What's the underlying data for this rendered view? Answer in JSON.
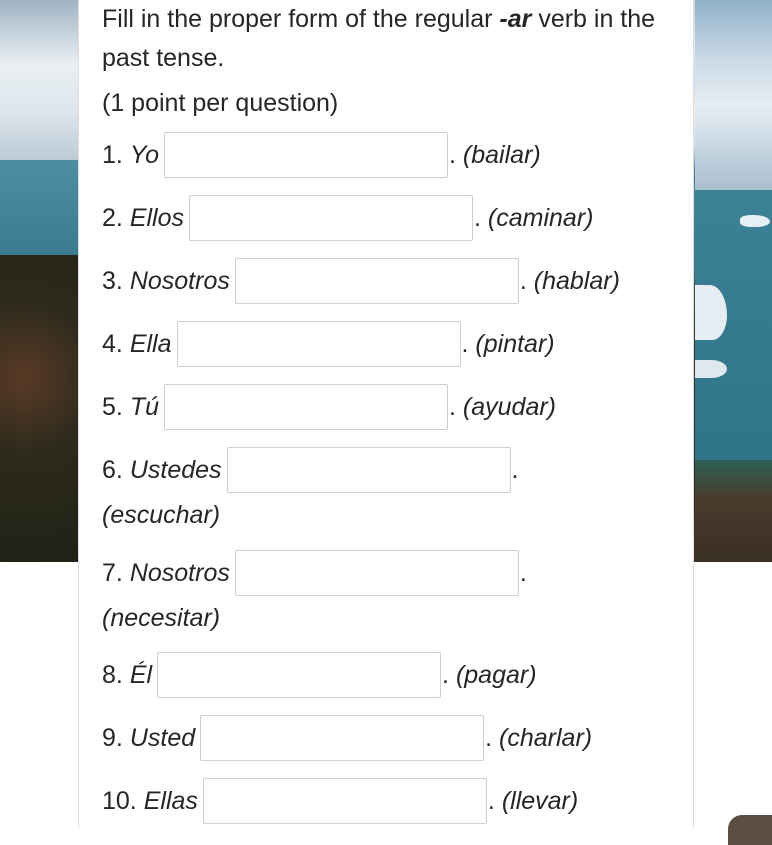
{
  "instructions": {
    "line_prefix": "Fill in the proper form of the regular ",
    "emphasis": "-ar",
    "line_suffix": " verb in the past tense.",
    "points_note": "(1 point per question)"
  },
  "questions": [
    {
      "number": "1.",
      "subject": "Yo",
      "value": "",
      "verb": "(bailar)"
    },
    {
      "number": "2.",
      "subject": "Ellos",
      "value": "",
      "verb": "(caminar)"
    },
    {
      "number": "3.",
      "subject": "Nosotros",
      "value": "",
      "verb": "(hablar)"
    },
    {
      "number": "4.",
      "subject": "Ella",
      "value": "",
      "verb": "(pintar)"
    },
    {
      "number": "5.",
      "subject": "Tú",
      "value": "",
      "verb": "(ayudar)"
    },
    {
      "number": "6.",
      "subject": "Ustedes",
      "value": "",
      "verb": "(escuchar)"
    },
    {
      "number": "7.",
      "subject": "Nosotros",
      "value": "",
      "verb": "(necesitar)"
    },
    {
      "number": "8.",
      "subject": "Él",
      "value": "",
      "verb": "(pagar)"
    },
    {
      "number": "9.",
      "subject": "Usted",
      "value": "",
      "verb": "(charlar)"
    },
    {
      "number": "10.",
      "subject": "Ellas",
      "value": "",
      "verb": "(llevar)"
    }
  ],
  "punctuation": {
    "period": "."
  },
  "background": {
    "description": "glacier-lake-landscape"
  }
}
